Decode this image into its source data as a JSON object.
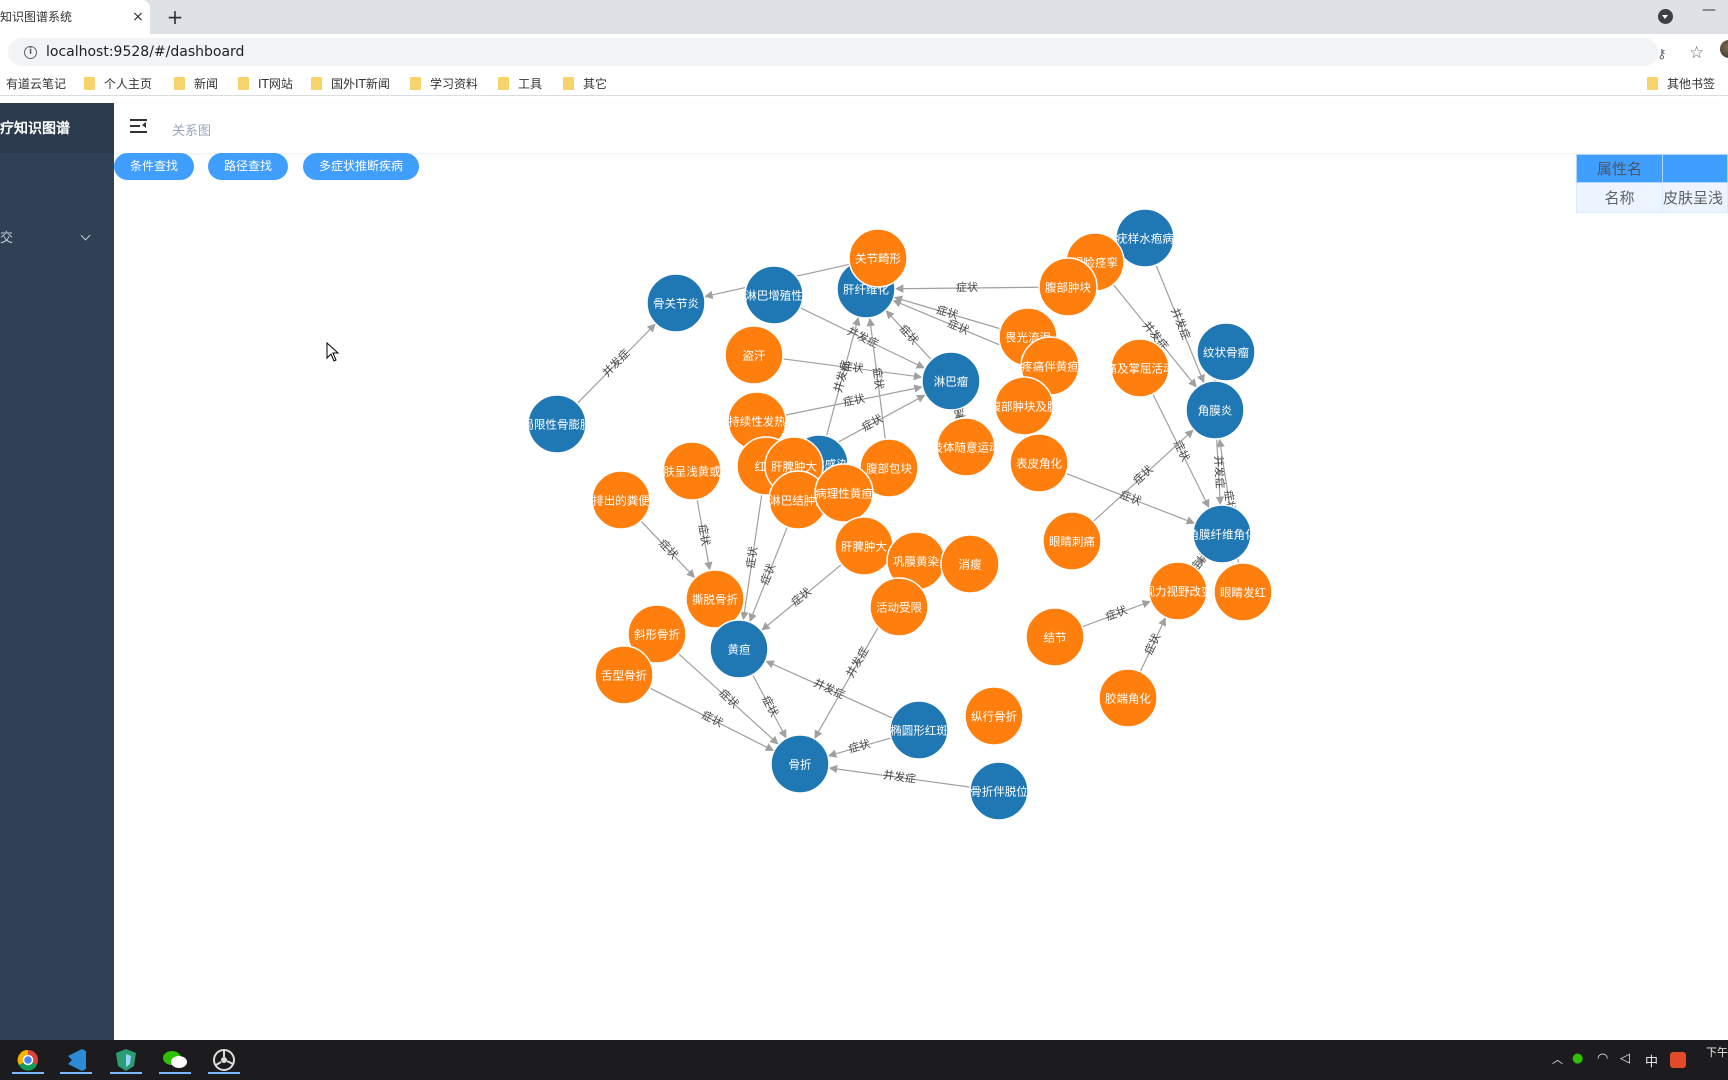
{
  "browser": {
    "tab_title": "知识图谱系统",
    "tab_close": "×",
    "new_tab": "+",
    "minimize": "—",
    "url": "localhost:9528/#/dashboard",
    "bookmarks": [
      {
        "label": "有道云笔记",
        "folder": false
      },
      {
        "label": "个人主页",
        "folder": true
      },
      {
        "label": "新闻",
        "folder": true
      },
      {
        "label": "IT网站",
        "folder": true
      },
      {
        "label": "国外IT新闻",
        "folder": true
      },
      {
        "label": "学习资料",
        "folder": true
      },
      {
        "label": "工具",
        "folder": true
      },
      {
        "label": "其它",
        "folder": true
      }
    ],
    "other_bookmarks": "其他书签"
  },
  "sidebar": {
    "title": "诊疗知识图谱",
    "menu_item": "交"
  },
  "header": {
    "breadcrumb": "关系图"
  },
  "toolbar": {
    "buttons": [
      "条件查找",
      "路径查找",
      "多症状推断疾病"
    ]
  },
  "property_table": {
    "headers": [
      "属性名",
      ""
    ],
    "rows": [
      [
        "名称",
        "皮肤呈浅"
      ]
    ]
  },
  "graph": {
    "colors": {
      "disease": "#1f77b4",
      "symptom": "#ff7f0e",
      "edge": "#a0a0a0"
    },
    "nodes": [
      {
        "id": "n1",
        "label": "骨关节炎",
        "type": "disease"
      },
      {
        "id": "n2",
        "label": "局限性骨膨胀",
        "type": "disease"
      },
      {
        "id": "n3",
        "label": "淋巴增殖性",
        "type": "disease"
      },
      {
        "id": "n4",
        "label": "肝纤维化",
        "type": "disease"
      },
      {
        "id": "n5",
        "label": "关节畸形",
        "type": "symptom"
      },
      {
        "id": "n6",
        "label": "疣样水疱病",
        "type": "disease"
      },
      {
        "id": "n7",
        "label": "眼睑痉挛",
        "type": "symptom"
      },
      {
        "id": "n8",
        "label": "腹部肿块",
        "type": "symptom"
      },
      {
        "id": "n9",
        "label": "纹状骨瘤",
        "type": "disease"
      },
      {
        "id": "n10",
        "label": "盗汗",
        "type": "symptom"
      },
      {
        "id": "n11",
        "label": "畏光流泪",
        "type": "symptom"
      },
      {
        "id": "n12",
        "label": "淋巴瘤",
        "type": "disease"
      },
      {
        "id": "n13",
        "label": "疼痛伴黄疸",
        "type": "symptom"
      },
      {
        "id": "n14",
        "label": "痛及掌屈活动",
        "type": "symptom"
      },
      {
        "id": "n15",
        "label": "角膜炎",
        "type": "disease"
      },
      {
        "id": "n16",
        "label": "持续性发热",
        "type": "symptom"
      },
      {
        "id": "n17",
        "label": "腹部肿块及腹",
        "type": "symptom"
      },
      {
        "id": "n18",
        "label": "肢体随意运动",
        "type": "symptom"
      },
      {
        "id": "n19",
        "label": "表皮角化",
        "type": "symptom"
      },
      {
        "id": "n20",
        "label": "病原体感染",
        "type": "disease"
      },
      {
        "id": "n21",
        "label": "皮肤呈浅黄或深",
        "type": "symptom"
      },
      {
        "id": "n22",
        "label": "红斑",
        "type": "symptom"
      },
      {
        "id": "n23",
        "label": "肝脾肿大",
        "type": "symptom"
      },
      {
        "id": "n24",
        "label": "腹部包块",
        "type": "symptom"
      },
      {
        "id": "n25",
        "label": "排出的粪便",
        "type": "symptom"
      },
      {
        "id": "n26",
        "label": "淋巴结肿大",
        "type": "symptom"
      },
      {
        "id": "n27",
        "label": "病理性黄疸",
        "type": "symptom"
      },
      {
        "id": "n28",
        "label": "眼睛刺痛",
        "type": "symptom"
      },
      {
        "id": "n29",
        "label": "角膜纤维角化",
        "type": "disease"
      },
      {
        "id": "n30",
        "label": "肝脾肿大",
        "type": "symptom"
      },
      {
        "id": "n31",
        "label": "巩膜黄染",
        "type": "symptom"
      },
      {
        "id": "n32",
        "label": "消瘦",
        "type": "symptom"
      },
      {
        "id": "n33",
        "label": "视力视野改变",
        "type": "symptom"
      },
      {
        "id": "n34",
        "label": "眼睛发红",
        "type": "symptom"
      },
      {
        "id": "n35",
        "label": "撕脱骨折",
        "type": "symptom"
      },
      {
        "id": "n36",
        "label": "斜形骨折",
        "type": "symptom"
      },
      {
        "id": "n37",
        "label": "黄疸",
        "type": "disease"
      },
      {
        "id": "n38",
        "label": "活动受限",
        "type": "symptom"
      },
      {
        "id": "n39",
        "label": "结节",
        "type": "symptom"
      },
      {
        "id": "n40",
        "label": "舌型骨折",
        "type": "symptom"
      },
      {
        "id": "n41",
        "label": "胶端角化",
        "type": "symptom"
      },
      {
        "id": "n42",
        "label": "纵行骨折",
        "type": "symptom"
      },
      {
        "id": "n43",
        "label": "椭圆形红斑",
        "type": "disease"
      },
      {
        "id": "n44",
        "label": "骨折",
        "type": "disease"
      },
      {
        "id": "n45",
        "label": "骨折伴脱位",
        "type": "disease"
      }
    ],
    "edges": [
      {
        "source": "n2",
        "target": "n1",
        "label": "并发症"
      },
      {
        "source": "n5",
        "target": "n1",
        "label": "症状"
      },
      {
        "source": "n8",
        "target": "n4",
        "label": "症状"
      },
      {
        "source": "n3",
        "target": "n12",
        "label": "并发症"
      },
      {
        "source": "n10",
        "target": "n12",
        "label": "症状"
      },
      {
        "source": "n16",
        "target": "n12",
        "label": "症状"
      },
      {
        "source": "n20",
        "target": "n4",
        "label": "并发症"
      },
      {
        "source": "n24",
        "target": "n4",
        "label": "症状"
      },
      {
        "source": "n11",
        "target": "n4",
        "label": "症状"
      },
      {
        "source": "n13",
        "target": "n4",
        "label": "症状"
      },
      {
        "source": "n12",
        "target": "n4",
        "label": "症状"
      },
      {
        "source": "n23",
        "target": "n12",
        "label": "症状"
      },
      {
        "source": "n18",
        "target": "n12",
        "label": "症状"
      },
      {
        "source": "n6",
        "target": "n15",
        "label": "并发症"
      },
      {
        "source": "n7",
        "target": "n15",
        "label": "并发症"
      },
      {
        "source": "n9",
        "target": "n15",
        "label": "并发症"
      },
      {
        "source": "n14",
        "target": "n29",
        "label": "症状"
      },
      {
        "source": "n28",
        "target": "n15",
        "label": "症状"
      },
      {
        "source": "n19",
        "target": "n29",
        "label": "症状"
      },
      {
        "source": "n15",
        "target": "n29",
        "label": "并发症"
      },
      {
        "source": "n34",
        "target": "n15",
        "label": "症状"
      },
      {
        "source": "n33",
        "target": "n29",
        "label": "症状"
      },
      {
        "source": "n39",
        "target": "n33",
        "label": "症状"
      },
      {
        "source": "n41",
        "target": "n33",
        "label": "症状"
      },
      {
        "source": "n25",
        "target": "n35",
        "label": "症状"
      },
      {
        "source": "n21",
        "target": "n35",
        "label": "症状"
      },
      {
        "source": "n22",
        "target": "n37",
        "label": "症状"
      },
      {
        "source": "n26",
        "target": "n37",
        "label": "症状"
      },
      {
        "source": "n30",
        "target": "n37",
        "label": "症状"
      },
      {
        "source": "n36",
        "target": "n44",
        "label": "症状"
      },
      {
        "source": "n40",
        "target": "n44",
        "label": "症状"
      },
      {
        "source": "n37",
        "target": "n44",
        "label": "症状"
      },
      {
        "source": "n43",
        "target": "n37",
        "label": "并发症"
      },
      {
        "source": "n31",
        "target": "n44",
        "label": "并发症"
      },
      {
        "source": "n43",
        "target": "n44",
        "label": "症状"
      },
      {
        "source": "n45",
        "target": "n44",
        "label": "并发症"
      }
    ]
  },
  "taskbar": {
    "apps": [
      "chrome",
      "vscode",
      "app-green",
      "wechat",
      "app-circle"
    ],
    "tray_text": "中",
    "clock": "下午"
  }
}
